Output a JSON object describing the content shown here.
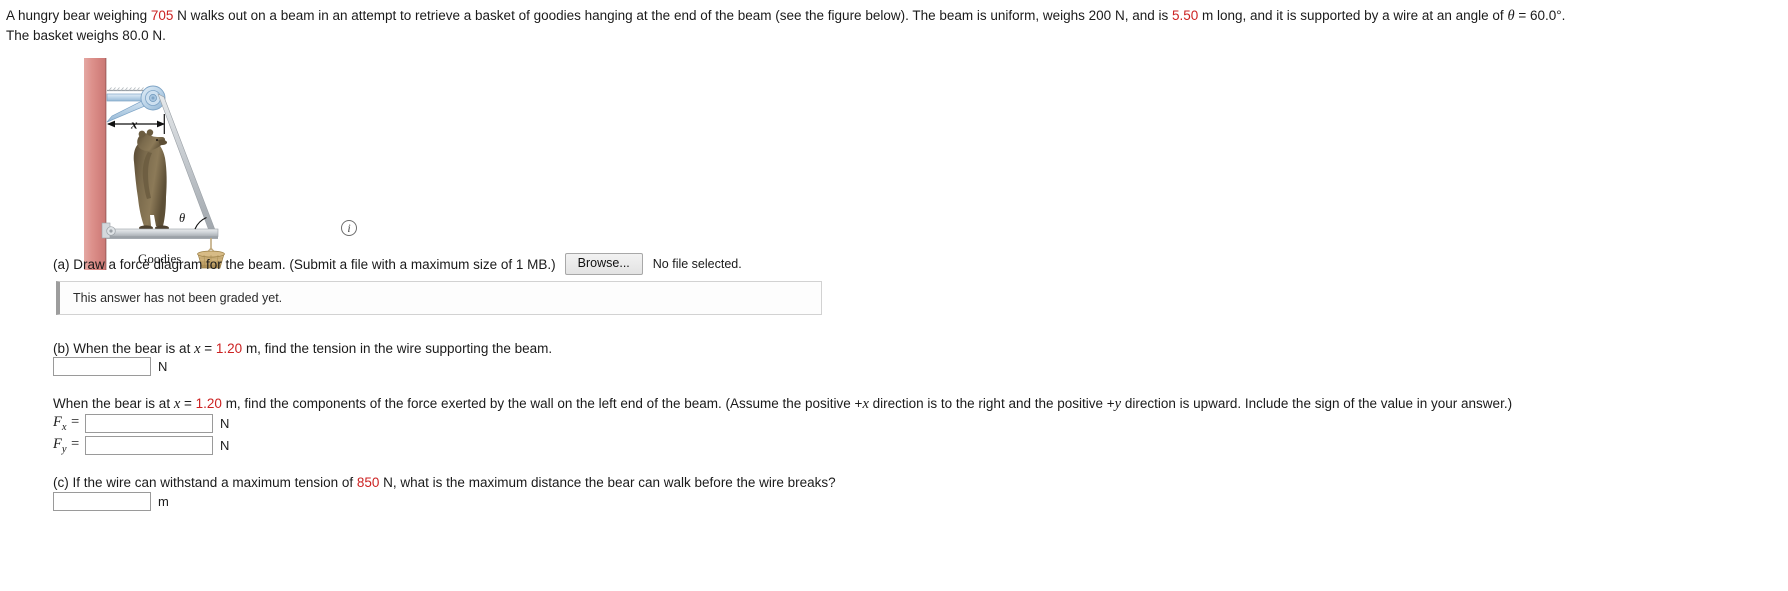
{
  "problem": {
    "line1_a": "A hungry bear weighing ",
    "weight_bear": "705",
    "line1_b": " N walks out on a beam in an attempt to retrieve a basket of goodies hanging at the end of the beam (see the figure below). The beam is uniform, weighs 200 N, and is ",
    "beam_length": "5.50",
    "line1_c": " m long, and it is supported by a wire at an angle of ",
    "theta_symbol": "θ",
    "line1_d": " = 60.0°.",
    "line2": "The basket weighs 80.0 N."
  },
  "figure": {
    "label_x": "x",
    "label_theta": "θ",
    "label_goodies": "Goodies",
    "info_icon_glyph": "i",
    "colors": {
      "wall": "#d98c88",
      "beam": "#c9cdd1",
      "wire": "#b9bec4",
      "pulley": "#b9d3e8",
      "bear": "#7a6a4f",
      "basket": "#c8a96b"
    }
  },
  "part_a": {
    "text": "(a) Draw a force diagram for the beam. (Submit a file with a maximum size of 1 MB.)",
    "browse_label": "Browse...",
    "no_file_text": "No file selected.",
    "graded_message": "This answer has not been graded yet."
  },
  "part_b": {
    "text_before": "(b) When the bear is at ",
    "var_x": "x",
    "eq": " = ",
    "x_value": "1.20",
    "text_after": " m, find the tension in the wire supporting the beam.",
    "input_value": "",
    "unit": "N"
  },
  "part_b2": {
    "text_before": "When the bear is at ",
    "var_x": "x",
    "eq": " = ",
    "x_value": "1.20",
    "text_mid": " m, find the components of the force exerted by the wall on the left end of the beam. (Assume the positive +",
    "var_x2": "x",
    "text_mid2": " direction is to the right and the positive +",
    "var_y": "y",
    "text_after": " direction is upward. Include the sign of the value in your answer.)",
    "fx_label_main": "F",
    "fx_label_sub": "x",
    "fy_label_main": "F",
    "fy_label_sub": "y",
    "equals": " = ",
    "fx_value": "",
    "fy_value": "",
    "unit": "N"
  },
  "part_c": {
    "text_before": "(c) If the wire can withstand a maximum tension of ",
    "tension_value": "850",
    "text_after": " N, what is the maximum distance the bear can walk before the wire breaks?",
    "input_value": "",
    "unit": "m"
  }
}
